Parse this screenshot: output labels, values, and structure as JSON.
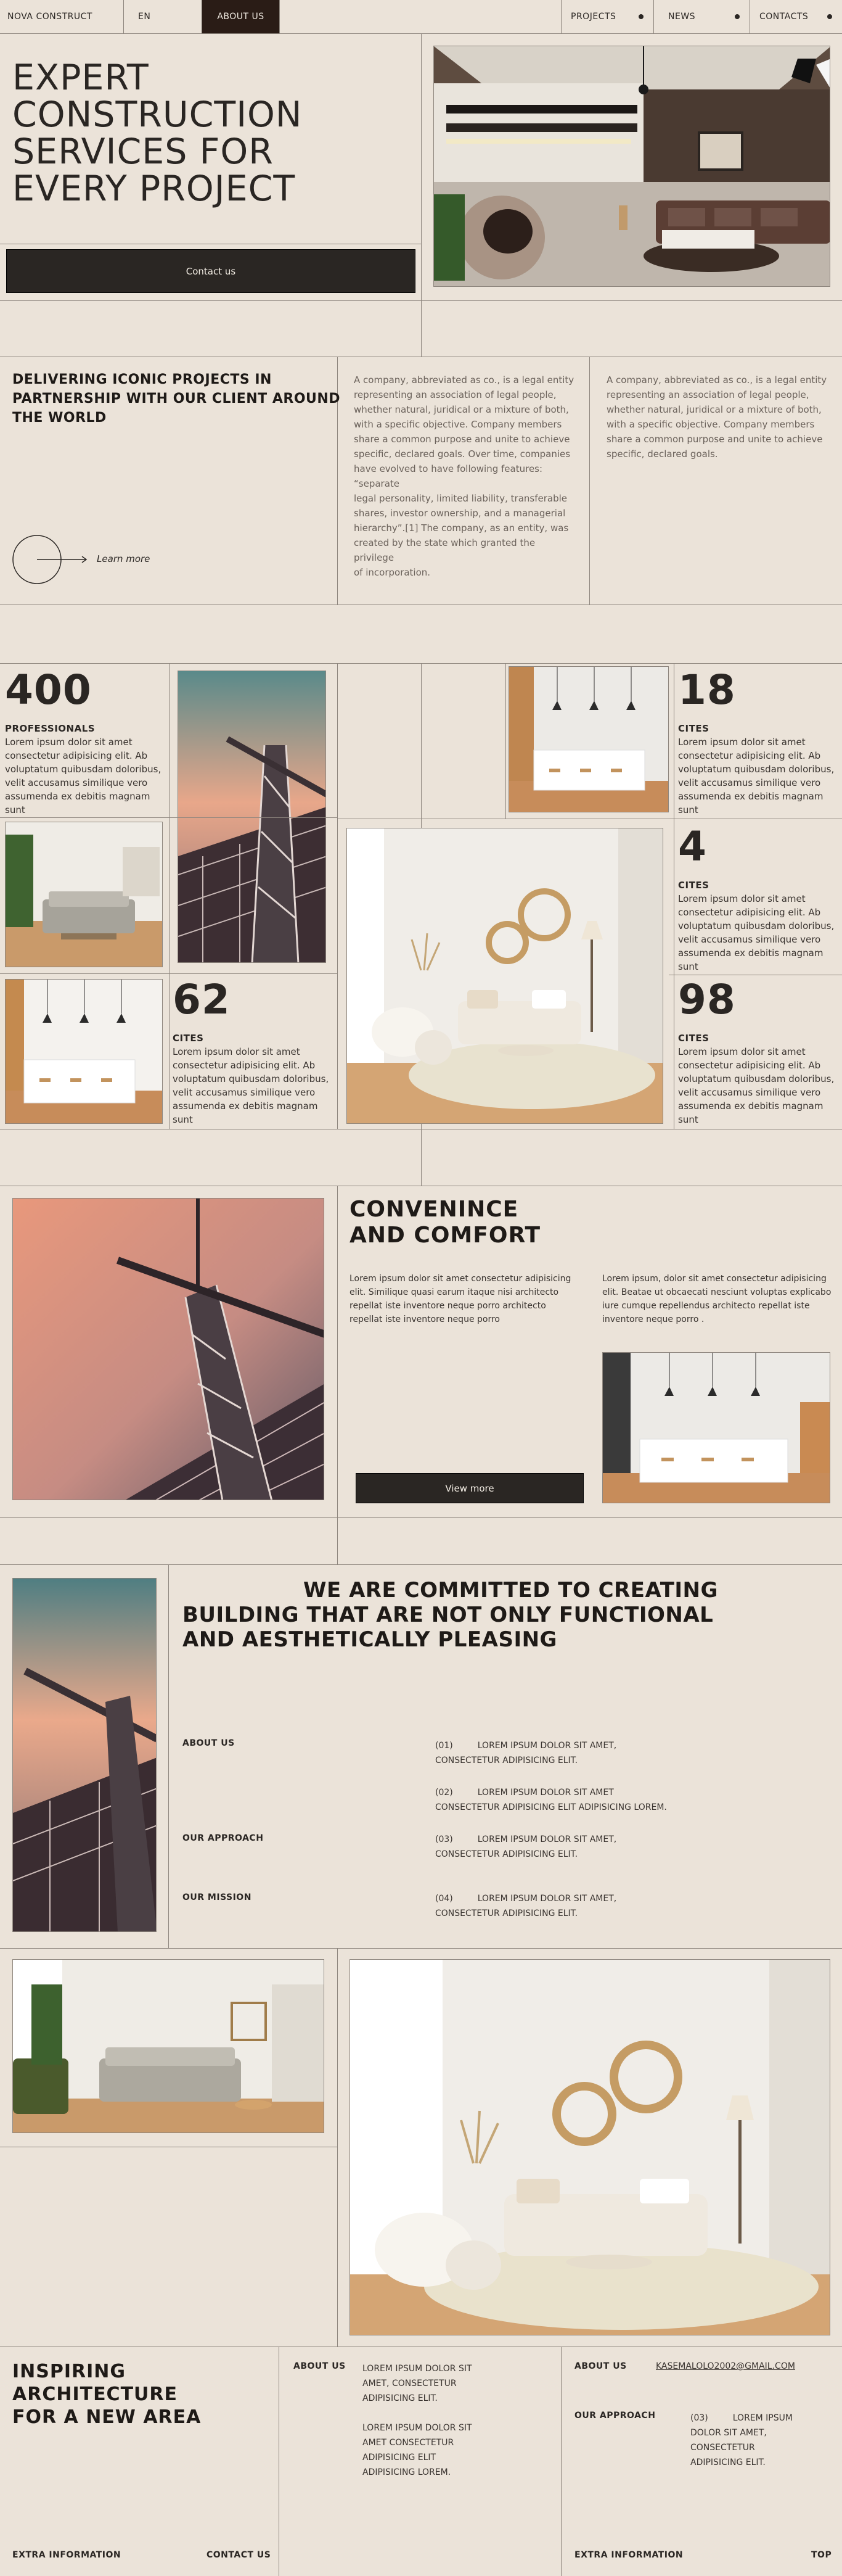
{
  "nav": {
    "brand": "NOVA CONSTRUCT",
    "lang": "EN",
    "about": "ABOUT US",
    "projects": "PROJECTS",
    "news": "NEWS",
    "contacts": "CONTACTS"
  },
  "hero": {
    "title_l1": "EXPERT",
    "title_l2": "CONSTRUCTION",
    "title_l3": "SERVICES FOR",
    "title_l4": "EVERY PROJECT",
    "cta": "Contact us"
  },
  "intro": {
    "heading_l1": "DELIVERING ICONIC PROJECTS IN",
    "heading_l2": "PARTNERSHIP WITH OUR CLIENT AROUND",
    "heading_l3": "THE WORLD",
    "learn_more": "Learn more",
    "col1": [
      "A company, abbreviated as co., is a legal entity",
      "representing an association of legal people,",
      "whether natural, juridical or a mixture of both,",
      "with a specific objective. Company members",
      "share a common purpose and unite to achieve",
      "specific, declared goals. Over time, companies",
      "have evolved to have following features: “separate",
      "legal personality, limited liability, transferable",
      "shares, investor ownership, and a managerial",
      "hierarchy”.[1] The company, as an entity, was",
      "created by the state which granted the privilege",
      "of incorporation."
    ],
    "col2": [
      "A company, abbreviated as co., is a legal entity",
      "representing an association of legal people,",
      "whether natural, juridical or a mixture of both,",
      "with a specific objective. Company members",
      "share a common purpose and unite to achieve",
      "specific, declared goals."
    ]
  },
  "stats": {
    "lorem": [
      "Lorem ipsum dolor sit amet",
      "consectetur adipisicing elit. Ab",
      "voluptatum quibusdam doloribus,",
      "velit accusamus similique vero",
      "assumenda ex debitis magnam sunt"
    ],
    "s1": {
      "num": "400",
      "label": "PROFESSIONALS"
    },
    "s2": {
      "num": "18",
      "label": "CITES"
    },
    "s3": {
      "num": "4",
      "label": "CITES"
    },
    "s4": {
      "num": "62",
      "label": "CITES"
    },
    "s5": {
      "num": "98",
      "label": "CITES"
    }
  },
  "comfort": {
    "title_l1": "CONVENINCE",
    "title_l2": "AND COMFORT",
    "p1": [
      "Lorem ipsum dolor sit amet consectetur adipisicing",
      "elit. Similique quasi earum itaque nisi architecto",
      "repellat iste inventore neque porro architecto",
      "repellat iste inventore neque porro"
    ],
    "p2": [
      "Lorem ipsum, dolor sit amet consectetur adipisicing",
      "elit. Beatae ut obcaecati nesciunt voluptas explicabo",
      "iure cumque repellendus architecto repellat iste",
      "inventore neque porro ."
    ],
    "cta": "View more"
  },
  "commit": {
    "title_l1": "WE ARE COMMITTED TO CREATING",
    "title_l2": "BUILDING THAT ARE NOT ONLY FUNCTIONAL",
    "title_l3": "AND AESTHETICALLY PLEASING",
    "about": "ABOUT US",
    "approach": "OUR APPROACH",
    "mission": "OUR MISSION",
    "i1_num": "(01)",
    "i1_l1": "LOREM IPSUM DOLOR SIT AMET,",
    "i1_l2": "CONSECTETUR ADIPISICING ELIT.",
    "i2_num": "(02)",
    "i2_l1": "LOREM IPSUM DOLOR SIT AMET",
    "i2_l2": "CONSECTETUR ADIPISICING ELIT ADIPISICING LOREM.",
    "i3_num": "(03)",
    "i3_l1": "LOREM IPSUM DOLOR SIT AMET,",
    "i3_l2": "CONSECTETUR ADIPISICING ELIT.",
    "i4_num": "(04)",
    "i4_l1": "LOREM IPSUM DOLOR SIT AMET,",
    "i4_l2": "CONSECTETUR ADIPISICING ELIT."
  },
  "footer": {
    "title_l1": "INSPIRING",
    "title_l2": "ARCHITECTURE",
    "title_l3": "FOR A NEW AREA",
    "about": "ABOUT US",
    "c2a": [
      "LOREM IPSUM DOLOR SIT",
      "AMET, CONSECTETUR",
      "ADIPISICING ELIT."
    ],
    "c2b": [
      "LOREM IPSUM DOLOR SIT",
      "AMET CONSECTETUR",
      "ADIPISICING ELIT",
      "ADIPISICING LOREM."
    ],
    "about2": "ABOUT US",
    "email": "KASEMALOLO2002@GMAIL.COM",
    "approach": "OUR APPROACH",
    "c4_num": "(03)",
    "c4": [
      "LOREM IPSUM",
      "DOLOR SIT AMET,",
      "CONSECTETUR",
      "ADIPISICING ELIT."
    ],
    "extra1": "EXTRA INFORMATION",
    "contact": "CONTACT US",
    "extra2": "EXTRA INFORMATION",
    "top": "TOP"
  },
  "icons": [
    "arrow-right-icon",
    "nav-dot-icon"
  ]
}
